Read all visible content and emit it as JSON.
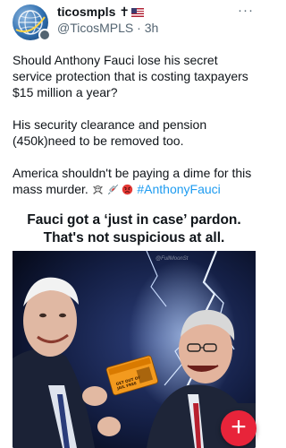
{
  "author": {
    "display_name": "ticosmpls",
    "name_suffix": "✝",
    "handle": "@TicosMPLS",
    "separator": "·",
    "time": "3h"
  },
  "tweet": {
    "para1": "Should Anthony Fauci lose his secret service protection that is costing taxpayers $15 million a year?",
    "para2": "His security clearance and pension (450k)need to be removed too.",
    "para3_text": "America shouldn't be paying a dime for this mass murder.",
    "hashtag": "#AnthonyFauci"
  },
  "meme": {
    "caption": "Fauci got a ‘just in case’ pardon. That's not suspicious at all.",
    "watermark": "@FullMoonSt",
    "card_text": "GET OUT OF JAIL FREE"
  },
  "icons": {
    "more": "more-horizontal-icon",
    "fab": "compose-plus-icon"
  },
  "colors": {
    "hashtag": "#1d9bf0",
    "fab": "#e8243a",
    "muted": "#536471"
  }
}
